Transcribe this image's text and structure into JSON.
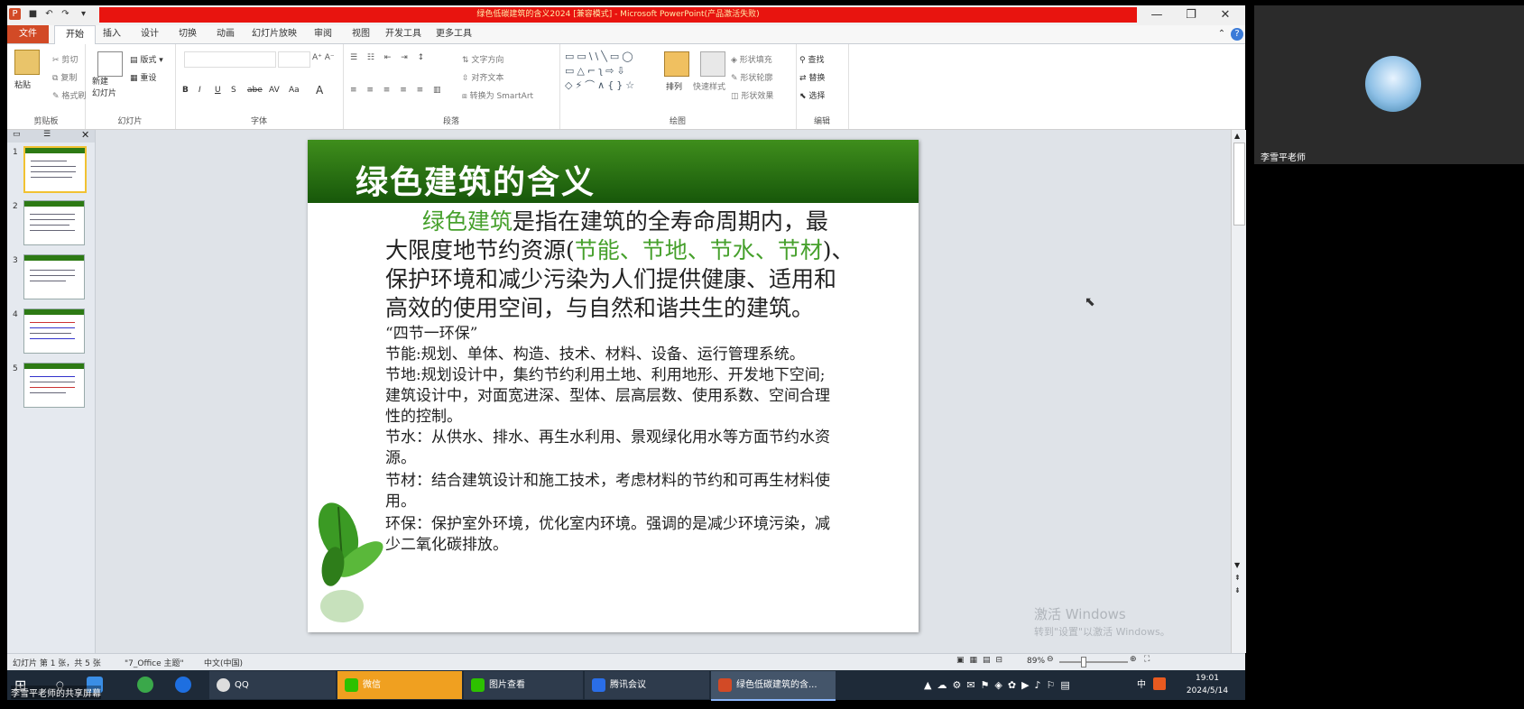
{
  "window": {
    "title": "绿色低碳建筑的含义2024 [兼容模式] - Microsoft PowerPoint(产品激活失败)",
    "controls": {
      "minimize": "—",
      "restore": "❐",
      "close": "✕"
    }
  },
  "tabs": [
    "文件",
    "开始",
    "插入",
    "设计",
    "切换",
    "动画",
    "幻灯片放映",
    "审阅",
    "视图",
    "开发工具",
    "更多工具"
  ],
  "ribbon": {
    "clipboard": {
      "label": "剪贴板",
      "paste": "粘贴",
      "cut": "剪切",
      "copy": "复制",
      "format_painter": "格式刷"
    },
    "slides": {
      "label": "幻灯片",
      "new_slide": "新建\n幻灯片",
      "layout": "版式",
      "reset": "重设"
    },
    "font": {
      "label": "字体",
      "buttons": [
        "B",
        "I",
        "U",
        "S",
        "abe",
        "AV",
        "Aa",
        "A"
      ]
    },
    "paragraph": {
      "label": "段落",
      "text_direction": "文字方向",
      "align_text": "对齐文本",
      "smartart": "转换为 SmartArt"
    },
    "drawing": {
      "label": "绘图",
      "arrange": "排列",
      "quick_styles": "快速样式",
      "shape_fill": "形状填充",
      "shape_outline": "形状轮廓",
      "shape_effects": "形状效果"
    },
    "editing": {
      "label": "编辑",
      "find": "查找",
      "replace": "替换",
      "select": "选择"
    }
  },
  "thumbnails": [
    "1",
    "2",
    "3",
    "4",
    "5"
  ],
  "slide": {
    "title": "绿色建筑的含义",
    "intro_green": "绿色建筑",
    "intro_1": "是指在建筑的全寿命周期内，最",
    "intro_2a": "大限度地节约资源(",
    "intro_2_green": "节能、节地、节水、节材",
    "intro_2b": ")、",
    "intro_3": "保护环境和减少污染为人们提供健康、适用和",
    "intro_4": "高效的使用空间，与自然和谐共生的建筑。",
    "subheading": "“四节一环保”",
    "energy": "节能:规划、单体、构造、技术、材料、设备、运行管理系统。",
    "land_1": "节地:规划设计中，集约节约利用土地、利用地形、开发地下空间;",
    "land_2": "建筑设计中，对面宽进深、型体、层高层数、使用系数、空间合理",
    "land_3": "性的控制。",
    "water_1": "节水：从供水、排水、再生水利用、景观绿化用水等方面节约水资",
    "water_2": "源。",
    "material_1": "节材：结合建筑设计和施工技术，考虑材料的节约和可再生材料使",
    "material_2": "用。",
    "env_1": "环保：保护室外环境，优化室内环境。强调的是减少环境污染，减",
    "env_2": "少二氧化碳排放。"
  },
  "watermark": {
    "line1": "激活 Windows",
    "line2": "转到\"设置\"以激活 Windows。"
  },
  "status": {
    "slide_info": "幻灯片 第 1 张，共 5 张",
    "theme": "\"7_Office 主题\"",
    "language": "中文(中国)",
    "zoom": "89%"
  },
  "taskbar": {
    "items": [
      "QQ",
      "微信",
      "图片查看",
      "腾讯会议",
      "绿色低碳建筑的含..."
    ],
    "time": "19:01",
    "date": "2024/5/14",
    "ime": "中",
    "share_label": "李雪平老师的共享屏幕"
  },
  "video": {
    "name": "李雪平老师"
  },
  "colors": {
    "title_red": "#e8140f",
    "slide_green": "#2d7a14",
    "highlight_green": "#46a02c",
    "wechat_active": "#f0a020"
  }
}
